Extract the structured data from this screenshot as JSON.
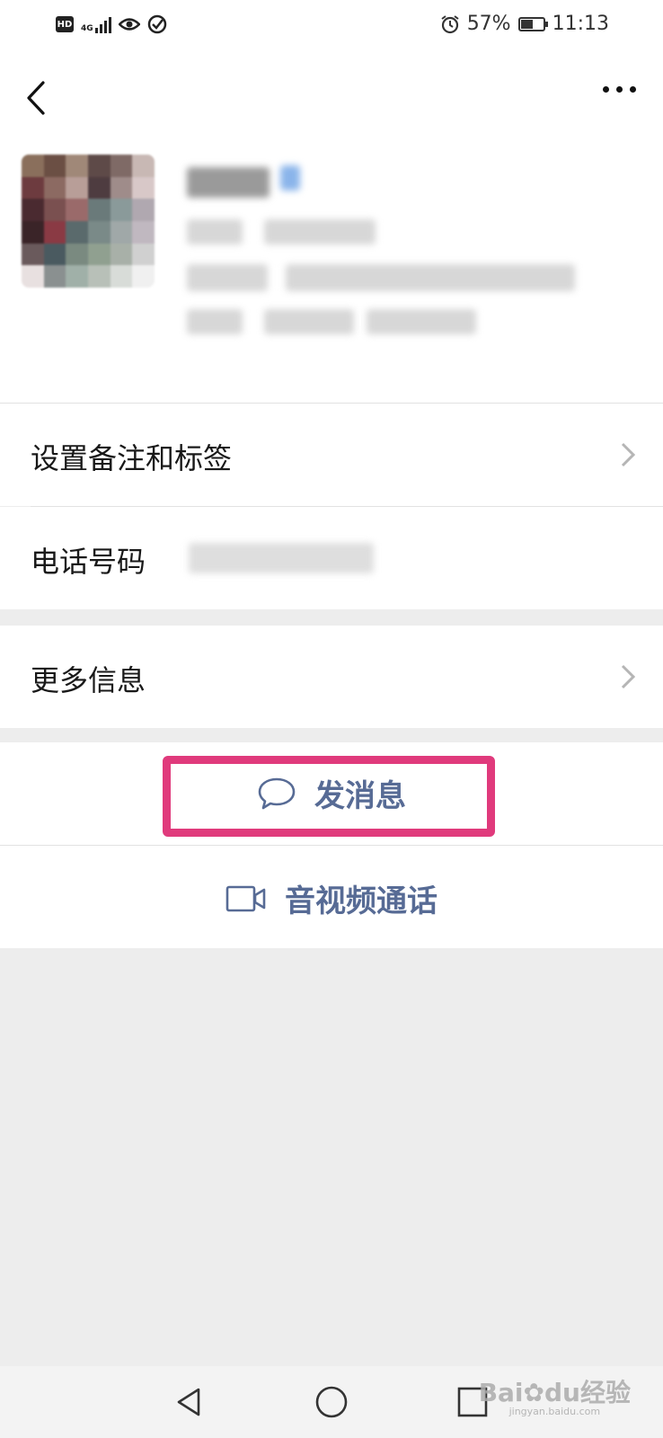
{
  "status_bar": {
    "hd": "HD",
    "network": "4G",
    "battery_text": "57%",
    "battery_level": 0.57,
    "time": "11:13"
  },
  "header": {
    "back_icon": "chevron-left-icon",
    "more_icon": "more-dots-icon"
  },
  "profile": {
    "avatar": "avatar-pixelated"
  },
  "rows": {
    "remark_tags": {
      "label": "设置备注和标签",
      "icon": "chevron-right-icon"
    },
    "phone": {
      "label": "电话号码"
    },
    "more_info": {
      "label": "更多信息",
      "icon": "chevron-right-icon"
    }
  },
  "actions": {
    "send_message": {
      "label": "发消息",
      "icon": "chat-bubble-icon"
    },
    "video_call": {
      "label": "音视频通话",
      "icon": "video-camera-icon"
    }
  },
  "watermark": {
    "brand": "Bai",
    "brand2": "du",
    "brand3": "经验",
    "url": "jingyan.baidu.com"
  },
  "colors": {
    "link_blue": "#576b95",
    "highlight": "#e03a7c",
    "background": "#ededed"
  }
}
